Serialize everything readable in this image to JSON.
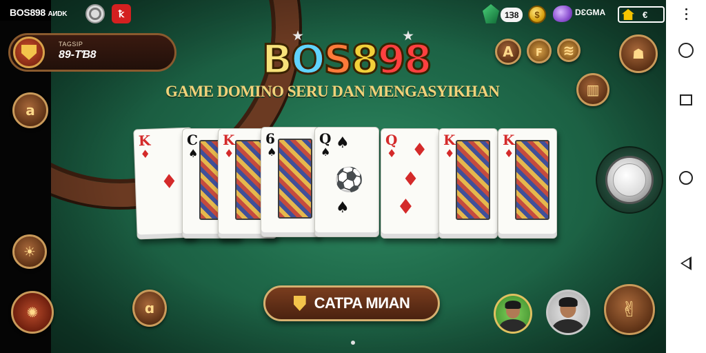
{
  "status_bar": {
    "app_name": "BOS898",
    "app_suffix": "AИDK",
    "red_icon_glyph": "ꝁ",
    "gems": "1Ɜ8",
    "coin_glyph": "$",
    "purple_label": "DƐGMA",
    "battery_text": "€"
  },
  "profile": {
    "label": "TAGSIP",
    "value": "89-TƁ8"
  },
  "logo": {
    "parts": [
      "B",
      "O",
      "S",
      "8",
      "98"
    ]
  },
  "tagline": "GAME DOMINO SERU DAN MENGASYIKHAN",
  "cards": [
    {
      "rank": "K",
      "suit": "♦",
      "color": "red"
    },
    {
      "rank": "C",
      "suit": "♠",
      "color": "blk"
    },
    {
      "rank": "K",
      "suit": "♦",
      "color": "red"
    },
    {
      "rank": "6",
      "suit": "♠",
      "color": "blk"
    },
    {
      "rank": "Q",
      "suit": "♠",
      "color": "blk"
    },
    {
      "rank": "Q",
      "suit": "♦",
      "color": "red"
    },
    {
      "rank": "K",
      "suit": "♦",
      "color": "red"
    },
    {
      "rank": "K",
      "suit": "♦",
      "color": "red"
    }
  ],
  "left_buttons": {
    "top_glyph": "a",
    "mid_glyph": "☀",
    "bottom_glyph": "✺"
  },
  "right_buttons": {
    "r1_glyph": "A",
    "r2_glyph": "ꜰ",
    "r3_glyph": "≋",
    "r4_glyph": "☗",
    "r5_glyph": "▥",
    "br_glyph": "✌"
  },
  "bottom_left_glyph": "ɑ",
  "play_button": {
    "label": "CATPA MИAN"
  },
  "colors": {
    "felt": "#1f6a4a",
    "rail": "#6b3a22",
    "gold": "#f1d27a"
  }
}
